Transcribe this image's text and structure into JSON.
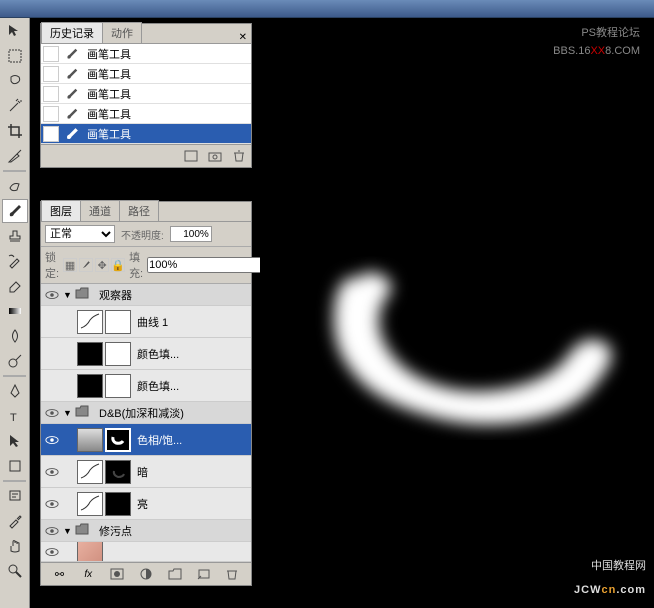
{
  "watermark": {
    "top_line1": "PS教程论坛",
    "top_line2_pre": "BBS.16",
    "top_line2_mid": "XX",
    "top_line2_post": "8.COM",
    "bottom_line1": "中国教程网",
    "bottom_line2_pre": "JCW",
    "bottom_line2_mid": "cn",
    "bottom_line2_post": ".com"
  },
  "history_panel": {
    "tabs": {
      "history": "历史记录",
      "actions": "动作"
    },
    "items": [
      {
        "label": "画笔工具"
      },
      {
        "label": "画笔工具"
      },
      {
        "label": "画笔工具"
      },
      {
        "label": "画笔工具"
      },
      {
        "label": "画笔工具"
      }
    ]
  },
  "layers_panel": {
    "tabs": {
      "layers": "图层",
      "channels": "通道",
      "paths": "路径"
    },
    "blend_mode": "正常",
    "opacity_label": "不透明度:",
    "opacity_value": "100%",
    "lock_label": "锁定:",
    "fill_label": "填充:",
    "fill_value": "100%",
    "groups": {
      "observer": "观察器",
      "dnb": "D&B(加深和减淡)",
      "repair": "修污点"
    },
    "layers": {
      "curves1": "曲线 1",
      "colorfill1": "颜色填...",
      "colorfill2": "颜色填...",
      "huesat": "色相/饱...",
      "dark": "暗",
      "light": "亮"
    }
  }
}
